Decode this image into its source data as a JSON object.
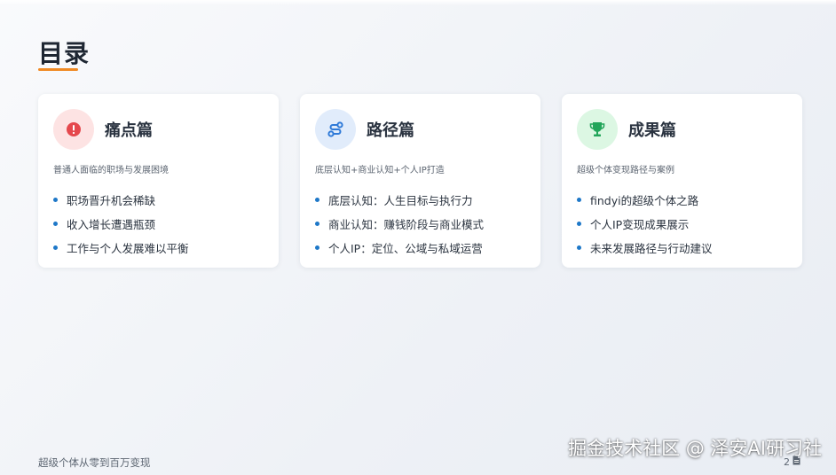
{
  "page": {
    "title": "目录",
    "footer": "超级个体从零到百万变现",
    "page_number": "2",
    "watermark": "掘金技术社区 @ 泽安AI研习社"
  },
  "colors": {
    "accent_underline": "#f08a24",
    "bullet": "#1e78c8",
    "card1_icon_bg": "#fde3e3",
    "card1_icon": "#e5484d",
    "card2_icon_bg": "#e1ecfb",
    "card2_icon": "#2f7ad8",
    "card3_icon_bg": "#dcf7e3",
    "card3_icon": "#22a55a"
  },
  "cards": [
    {
      "icon": "exclamation-circle-icon",
      "title": "痛点篇",
      "subtitle": "普通人面临的职场与发展困境",
      "items": [
        "职场晋升机会稀缺",
        "收入增长遭遇瓶颈",
        "工作与个人发展难以平衡"
      ]
    },
    {
      "icon": "route-icon",
      "title": "路径篇",
      "subtitle": "底层认知+商业认知+个人IP打造",
      "items": [
        "底层认知：人生目标与执行力",
        "商业认知：赚钱阶段与商业模式",
        "个人IP：定位、公域与私域运营"
      ]
    },
    {
      "icon": "trophy-icon",
      "title": "成果篇",
      "subtitle": "超级个体变现路径与案例",
      "items": [
        "findyi的超级个体之路",
        "个人IP变现成果展示",
        "未来发展路径与行动建议"
      ]
    }
  ]
}
